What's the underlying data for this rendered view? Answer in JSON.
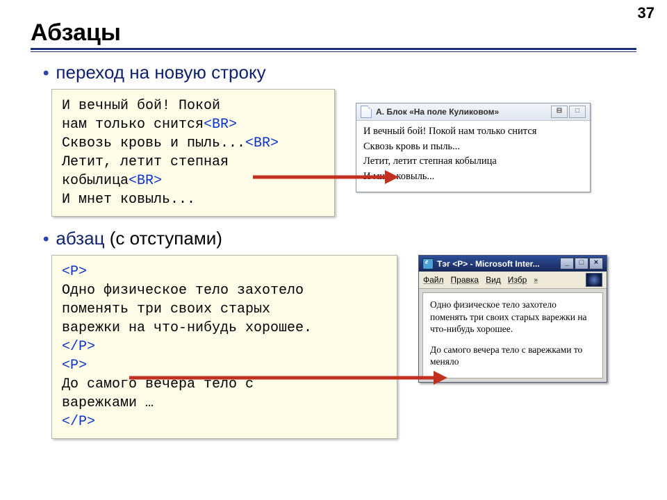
{
  "slide_number": "37",
  "title": "Абзацы",
  "bullets": {
    "b1": "переход на новую строку",
    "b2_a": "абзац",
    "b2_b": " (с отступами)"
  },
  "code1": {
    "l1": "И вечный бой! Покой",
    "l2a": "нам только снится",
    "l2b": "<BR>",
    "l3a": "Сквозь кровь и пыль...",
    "l3b": "<BR>",
    "l4": "Летит, летит степная",
    "l5a": "кобылица",
    "l5b": "<BR>",
    "l6": "И мнет ковыль..."
  },
  "preview1": {
    "title": "А. Блок  «На поле Куликовом»",
    "lines": {
      "l1": "И вечный бой! Покой нам только снится",
      "l2": "Сквозь кровь и пыль...",
      "l3": "Летит, летит степная кобылица",
      "l4": "И мнет ковыль..."
    },
    "btn1": "⊟",
    "btn2": "□"
  },
  "code2": {
    "l1": "<P>",
    "l2": "Одно физическое тело захотело",
    "l3": "поменять три своих старых",
    "l4": "варежки на что-нибудь хорошее.",
    "l5": "</P>",
    "l6": "<P>",
    "l7": "До самого вечера тело с",
    "l8": "варежками …",
    "l9": "</P>"
  },
  "preview2": {
    "title": "Тэг <P> - Microsoft Inter...",
    "menu": {
      "m1": "Файл",
      "m2": "Правка",
      "m3": "Вид",
      "m4": "Избр",
      "ch": "»"
    },
    "btn_min": "_",
    "btn_max": "□",
    "btn_close": "×",
    "p1": "Одно физическое тело захотело поменять три своих старых варежки на что-нибудь хорошее.",
    "p2": "До самого вечера тело с варежками то меняло"
  }
}
